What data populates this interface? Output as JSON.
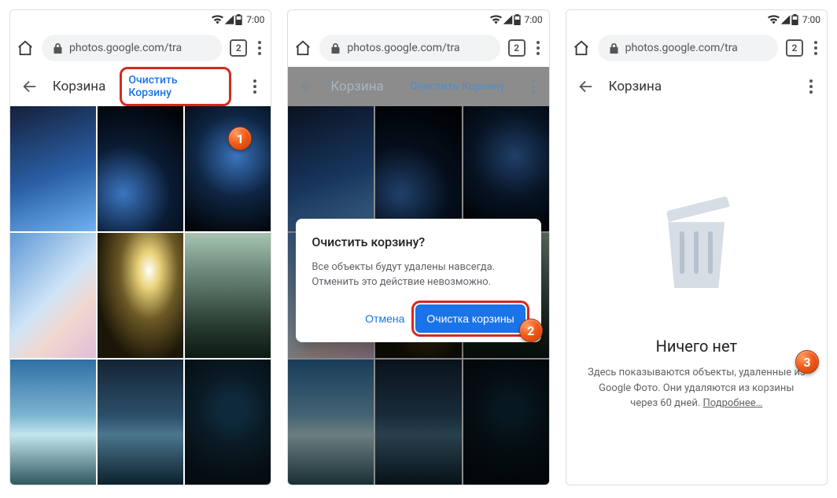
{
  "statusbar": {
    "time": "7:00"
  },
  "urlbar": {
    "url_text": "photos.google.com/tra",
    "tab_count": "2"
  },
  "page": {
    "title": "Корзина",
    "empty_link": "Очистить Корзину"
  },
  "dialog": {
    "title": "Очистить корзину?",
    "body": "Все объекты будут удалены навсегда. Отменить это действие невозможно.",
    "cancel": "Отмена",
    "confirm": "Очистка корзины"
  },
  "empty": {
    "title": "Ничего нет",
    "desc_pre": "Здесь показываются объекты, удаленные из Google Фото. Они удаляются из корзины через 60 дней. ",
    "more": "Подробнее…"
  },
  "steps": {
    "one": "1",
    "two": "2",
    "three": "3"
  }
}
